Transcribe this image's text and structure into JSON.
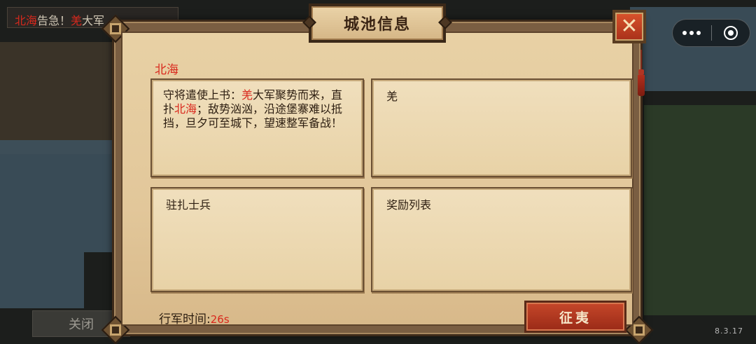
{
  "background": {
    "alert": {
      "city": "北海",
      "text1": "告急！",
      "enemy": "羌",
      "text2": "大军"
    },
    "close_label": "关闭",
    "version": "8.3.17"
  },
  "dialog": {
    "title": "城池信息",
    "close_symbol": "✕",
    "city_name": "北海",
    "report": {
      "part1": "守将遣使上书：",
      "enemy": "羌",
      "part2": "大军聚势而来，直扑",
      "city": "北海",
      "part3": "；敌势汹汹，沿途堡寨难以抵挡，旦夕可至城下，望速整军备战！"
    },
    "enemy_panel_label": "羌",
    "garrison_label": "驻扎士兵",
    "rewards_label": "奖励列表",
    "march_time_label": "行军时间:",
    "march_time_value": "26s",
    "expedition_label": "征夷"
  },
  "colors": {
    "accent_red": "#d9281d",
    "parchment": "#e8d2a6",
    "frame": "#5c432b"
  }
}
